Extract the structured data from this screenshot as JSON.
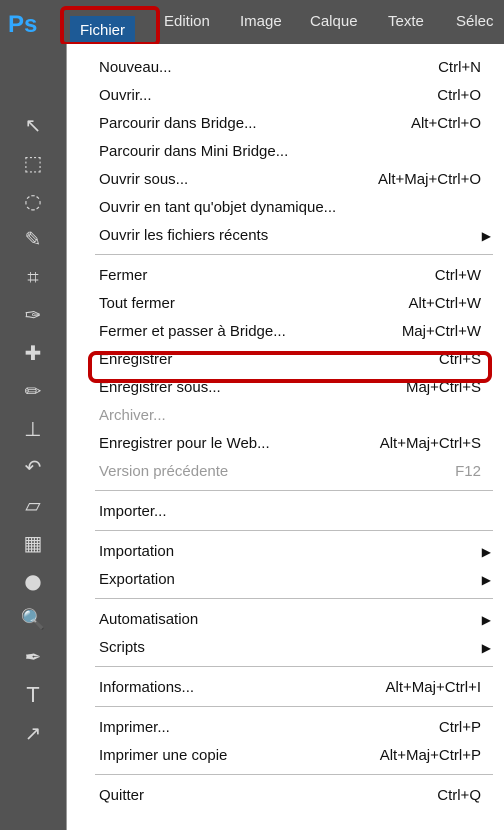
{
  "app": {
    "logo": "Ps",
    "menubar": [
      {
        "label": "Fichier",
        "active": true
      },
      {
        "label": "Edition"
      },
      {
        "label": "Image"
      },
      {
        "label": "Calque"
      },
      {
        "label": "Texte"
      },
      {
        "label": "Sélec"
      }
    ]
  },
  "toolbar": {
    "icons": [
      "move-icon",
      "marquee-icon",
      "lasso-icon",
      "quick-selection-icon",
      "crop-icon",
      "eyedropper-icon",
      "healing-brush-icon",
      "brush-icon",
      "clone-stamp-icon",
      "history-brush-icon",
      "eraser-icon",
      "gradient-icon",
      "blur-icon",
      "dodge-icon",
      "pen-icon",
      "type-icon",
      "path-selection-icon"
    ]
  },
  "menu": {
    "sections": [
      [
        {
          "label": "Nouveau...",
          "shortcut": "Ctrl+N"
        },
        {
          "label": "Ouvrir...",
          "shortcut": "Ctrl+O"
        },
        {
          "label": "Parcourir dans Bridge...",
          "shortcut": "Alt+Ctrl+O"
        },
        {
          "label": "Parcourir dans Mini Bridge...",
          "shortcut": ""
        },
        {
          "label": "Ouvrir sous...",
          "shortcut": "Alt+Maj+Ctrl+O"
        },
        {
          "label": "Ouvrir en tant qu'objet dynamique...",
          "shortcut": ""
        },
        {
          "label": "Ouvrir les fichiers récents",
          "shortcut": "",
          "submenu": true
        }
      ],
      [
        {
          "label": "Fermer",
          "shortcut": "Ctrl+W"
        },
        {
          "label": "Tout fermer",
          "shortcut": "Alt+Ctrl+W"
        },
        {
          "label": "Fermer et passer à Bridge...",
          "shortcut": "Maj+Ctrl+W"
        },
        {
          "label": "Enregistrer",
          "shortcut": "Ctrl+S"
        },
        {
          "label": "Enregistrer sous...",
          "shortcut": "Maj+Ctrl+S",
          "highlighted": true
        },
        {
          "label": "Archiver...",
          "shortcut": "",
          "disabled": true
        },
        {
          "label": "Enregistrer pour le Web...",
          "shortcut": "Alt+Maj+Ctrl+S"
        },
        {
          "label": "Version précédente",
          "shortcut": "F12",
          "disabled": true
        }
      ],
      [
        {
          "label": "Importer...",
          "shortcut": ""
        }
      ],
      [
        {
          "label": "Importation",
          "shortcut": "",
          "submenu": true
        },
        {
          "label": "Exportation",
          "shortcut": "",
          "submenu": true
        }
      ],
      [
        {
          "label": "Automatisation",
          "shortcut": "",
          "submenu": true
        },
        {
          "label": "Scripts",
          "shortcut": "",
          "submenu": true
        }
      ],
      [
        {
          "label": "Informations...",
          "shortcut": "Alt+Maj+Ctrl+I"
        }
      ],
      [
        {
          "label": "Imprimer...",
          "shortcut": "Ctrl+P"
        },
        {
          "label": "Imprimer une copie",
          "shortcut": "Alt+Maj+Ctrl+P"
        }
      ],
      [
        {
          "label": "Quitter",
          "shortcut": "Ctrl+Q"
        }
      ]
    ]
  },
  "colors": {
    "menubar_bg": "#535353",
    "active_menu_bg": "#1d5a96",
    "highlight_outline": "#c00000",
    "disabled_text": "#9a9a9a"
  }
}
